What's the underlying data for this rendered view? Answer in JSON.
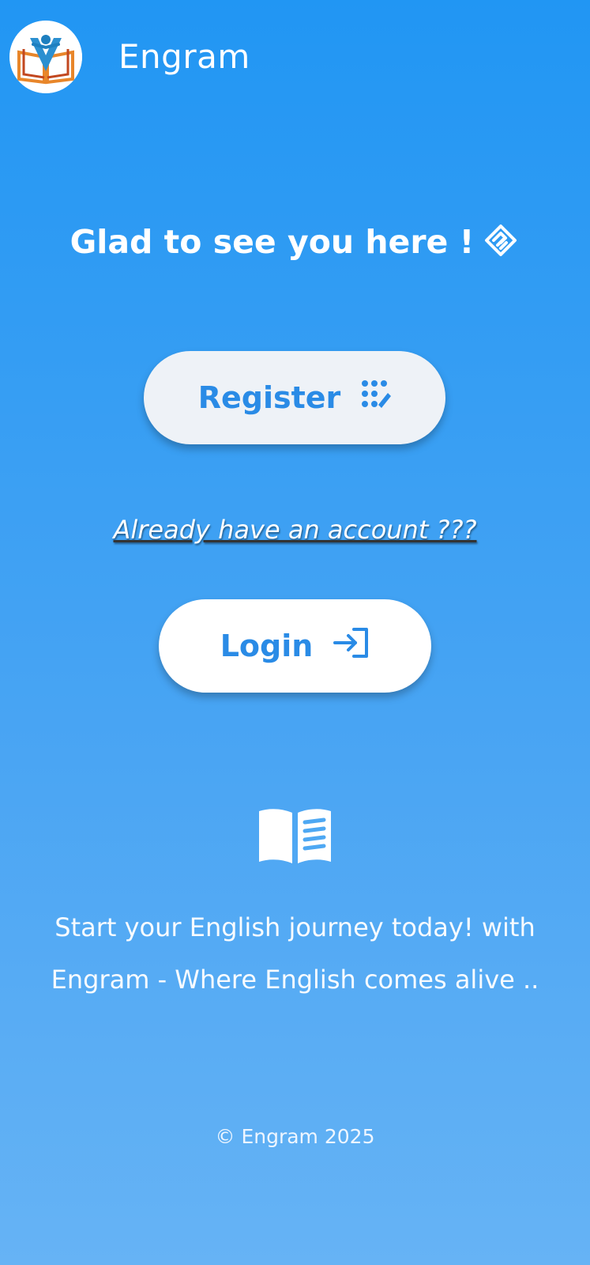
{
  "header": {
    "app_title": "Engram",
    "logo_icon": "engram-book-reader-logo"
  },
  "main": {
    "greeting": "Glad to see you here !",
    "greeting_icon": "handshake-icon",
    "register_button": {
      "label": "Register",
      "icon": "keypad-wand-icon"
    },
    "account_prompt": "Already have an account ???",
    "login_button": {
      "label": "Login",
      "icon": "login-arrow-icon"
    },
    "book_icon": "open-book-icon",
    "tagline_line1": "Start your English journey today! with",
    "tagline_line2": "Engram - Where English comes alive .."
  },
  "footer": {
    "copyright": "© Engram 2025"
  },
  "colors": {
    "background_top": "#2196F3",
    "background_bottom": "#66b3f5",
    "button_text": "#2a8be6",
    "register_bg": "#eef2f7",
    "login_bg": "#ffffff"
  }
}
